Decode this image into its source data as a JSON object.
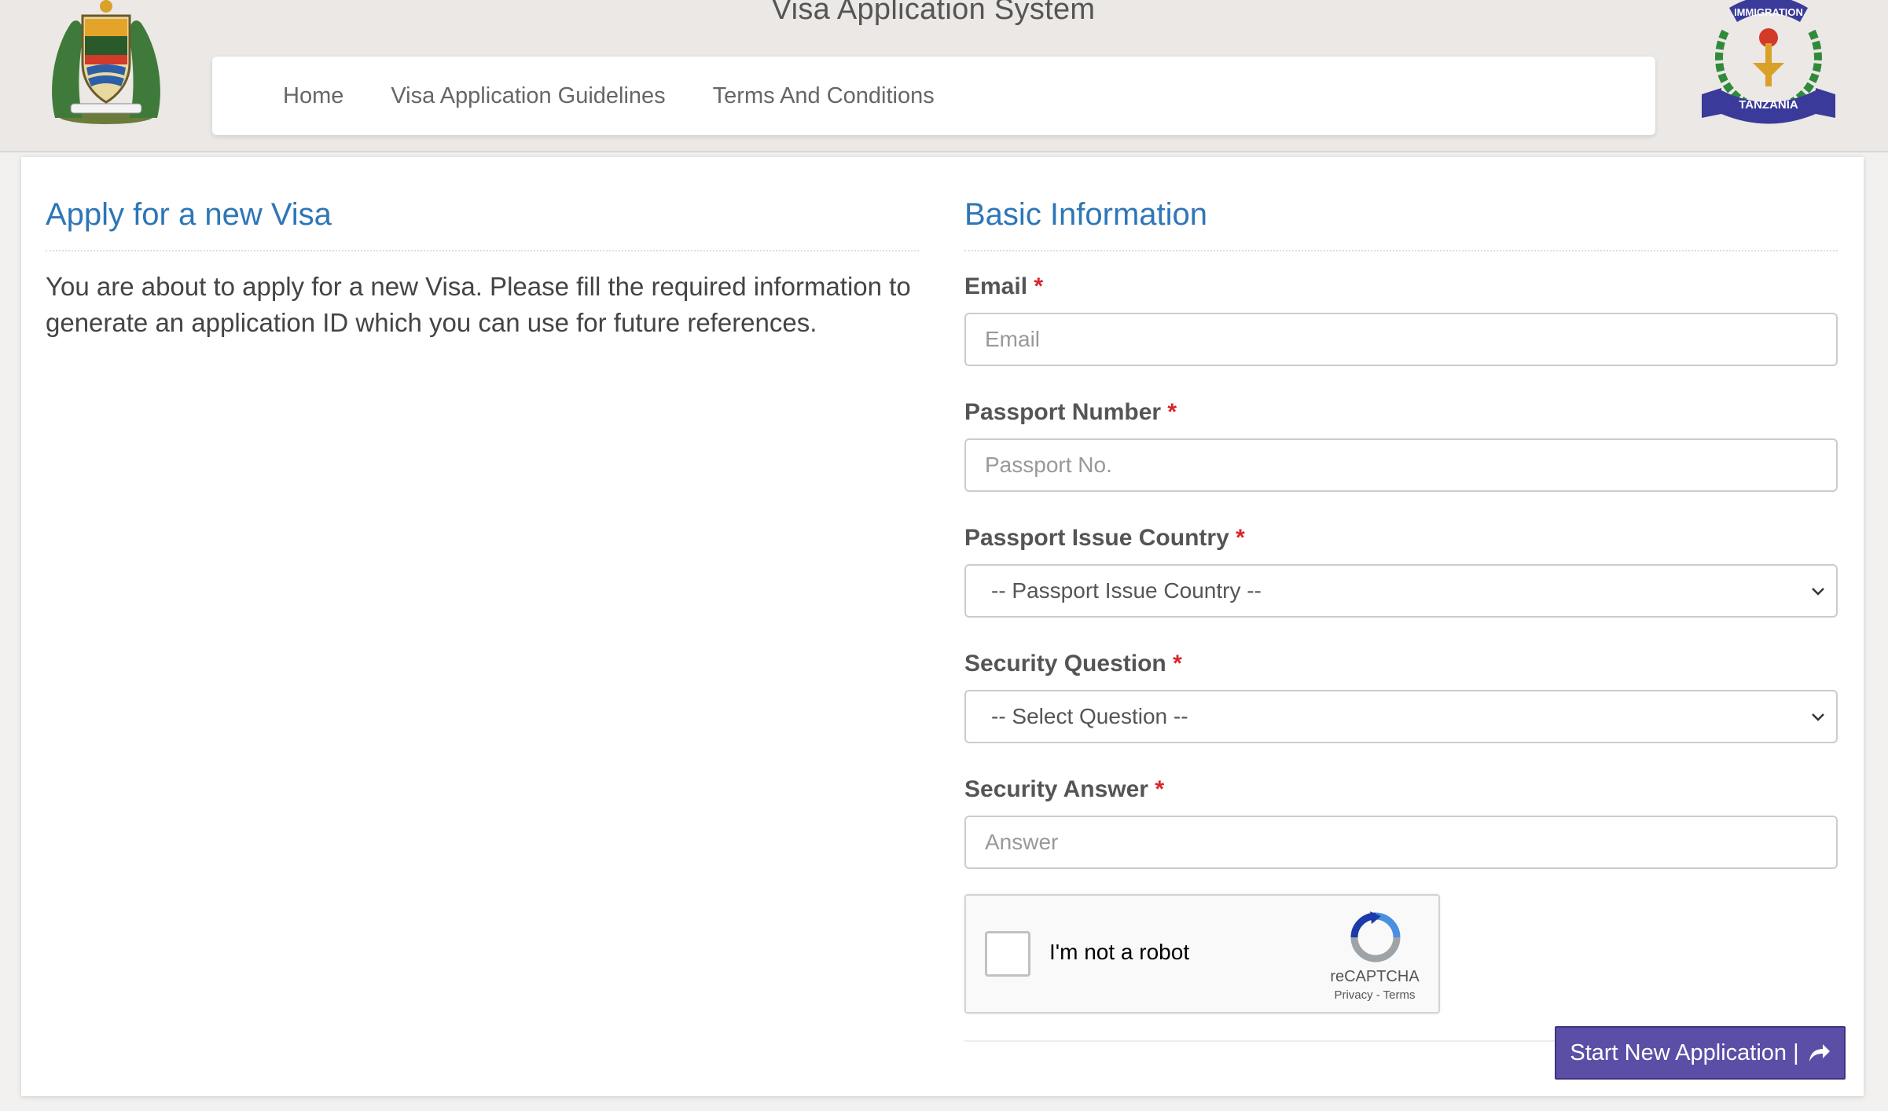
{
  "header": {
    "title": "Visa Application System",
    "nav": [
      "Home",
      "Visa Application Guidelines",
      "Terms And Conditions"
    ],
    "right_logo_text": [
      "IMMIGRATION",
      "TANZANIA"
    ]
  },
  "left": {
    "title": "Apply for a new Visa",
    "intro": "You are about to apply for a new Visa. Please fill the required information to generate an application ID which you can use for future references."
  },
  "form": {
    "title": "Basic Information",
    "required_mark": "*",
    "email": {
      "label": "Email",
      "placeholder": "Email"
    },
    "passport_number": {
      "label": "Passport Number",
      "placeholder": "Passport No."
    },
    "passport_country": {
      "label": "Passport Issue Country",
      "selected": "-- Passport Issue Country --"
    },
    "security_question": {
      "label": "Security Question",
      "selected": "-- Select Question --"
    },
    "security_answer": {
      "label": "Security Answer",
      "placeholder": "Answer"
    },
    "captcha": {
      "label": "I'm not a robot",
      "brand": "reCAPTCHA",
      "links": "Privacy - Terms"
    },
    "submit_label": "Start New Application |"
  },
  "colors": {
    "accent_blue": "#2e76b7",
    "button_purple": "#5b4ea6",
    "required_red": "#d9252b"
  }
}
